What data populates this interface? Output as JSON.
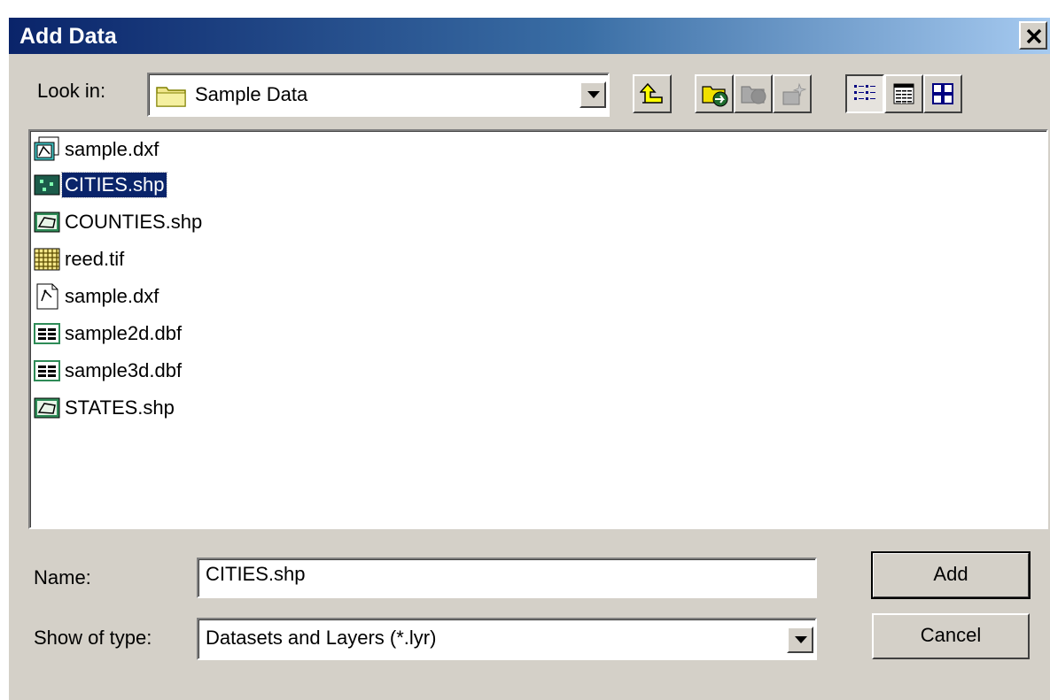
{
  "window": {
    "title": "Add Data"
  },
  "look_in": {
    "label": "Look in:",
    "value": "Sample Data"
  },
  "files": [
    {
      "name": "sample.dxf",
      "icon": "cad-dataset-icon"
    },
    {
      "name": "CITIES.shp",
      "icon": "point-shapefile-icon",
      "selected": true
    },
    {
      "name": "COUNTIES.shp",
      "icon": "polygon-shapefile-icon"
    },
    {
      "name": "reed.tif",
      "icon": "raster-icon"
    },
    {
      "name": "sample.dxf",
      "icon": "cad-drawing-icon"
    },
    {
      "name": "sample2d.dbf",
      "icon": "table-icon"
    },
    {
      "name": "sample3d.dbf",
      "icon": "table-icon"
    },
    {
      "name": "STATES.shp",
      "icon": "polygon-shapefile-icon"
    }
  ],
  "name_field": {
    "label": "Name:",
    "value": "CITIES.shp"
  },
  "type_field": {
    "label": "Show of type:",
    "value": "Datasets and Layers (*.lyr)"
  },
  "buttons": {
    "add": "Add",
    "cancel": "Cancel"
  },
  "colors": {
    "selection": "#0a246a",
    "dialog_bg": "#d4d0c8",
    "title_start": "#0a246a",
    "title_end": "#a6caf0"
  }
}
